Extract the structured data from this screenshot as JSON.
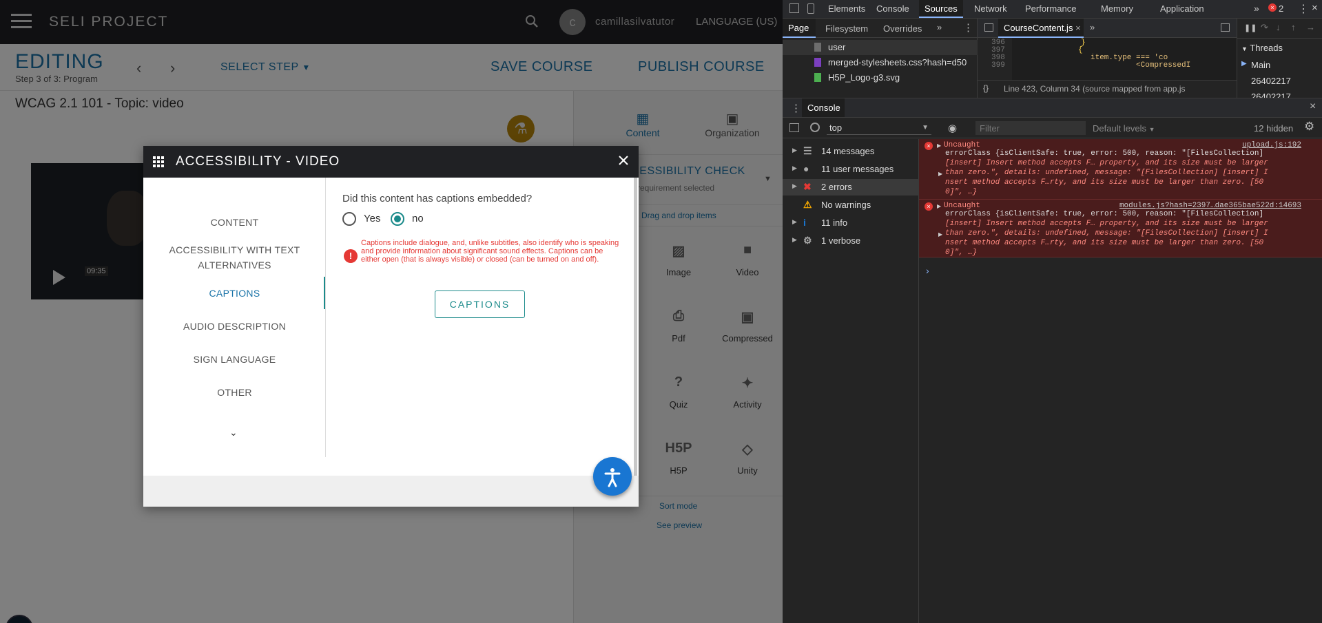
{
  "app": {
    "brand": "SELI PROJECT",
    "user_initial": "c",
    "username": "camillasilvatutor",
    "language": "LANGUAGE (US)",
    "editing": "EDITING",
    "step_text": "Step 3 of 3: Program",
    "select_step": "SELECT STEP",
    "save_course": "SAVE COURSE",
    "publish_course": "PUBLISH COURSE",
    "course_title": "WCAG 2.1 101 - Topic: video",
    "video_time": "09:35",
    "panel_tabs": [
      {
        "label": "Content"
      },
      {
        "label": "Organization"
      }
    ],
    "accessibility_check": "ACCESSIBILITY CHECK",
    "requirement": "requirement selected",
    "drag_drop": "Drag and drop items",
    "tools": [
      {
        "label": "Image",
        "icon": "image-icon"
      },
      {
        "label": "Video",
        "icon": "video-icon"
      },
      {
        "label": "Pdf",
        "icon": "pdf-icon"
      },
      {
        "label": "Compressed",
        "icon": "compressed-icon"
      },
      {
        "label": "Quiz",
        "icon": "quiz-icon"
      },
      {
        "label": "Activity",
        "icon": "activity-icon"
      },
      {
        "label": "H5P",
        "icon": "h5p-icon"
      },
      {
        "label": "Unity",
        "icon": "unity-icon"
      }
    ],
    "sort_mode": "Sort mode",
    "see_preview": "See preview"
  },
  "dialog": {
    "title": "ACCESSIBILITY - VIDEO",
    "nav": [
      "CONTENT",
      "ACCESSIBILITY WITH TEXT ALTERNATIVES",
      "CAPTIONS",
      "AUDIO DESCRIPTION",
      "SIGN LANGUAGE",
      "OTHER"
    ],
    "active_nav": "CAPTIONS",
    "question": "Did this content has captions embedded?",
    "yes": "Yes",
    "no": "no",
    "selected": "no",
    "warning": "Captions include dialogue, and, unlike subtitles, also identify who is speaking and provide information about significant sound effects. Captions can be either open (that is always visible) or closed (can be turned on and off).",
    "captions_button": "CAPTIONS"
  },
  "devtools": {
    "tabs": [
      "Elements",
      "Console",
      "Sources",
      "Network",
      "Performance",
      "Memory",
      "Application"
    ],
    "active_tab": "Sources",
    "error_count": "2",
    "sources_tabs": [
      "Page",
      "Filesystem",
      "Overrides"
    ],
    "files": [
      {
        "name": "user",
        "color": "#6d6d6d"
      },
      {
        "name": "merged-stylesheets.css?hash=d50",
        "color": "#7b3fbf"
      },
      {
        "name": "H5P_Logo-g3.svg",
        "color": "#4caf50"
      }
    ],
    "open_file": "CourseContent.js",
    "code": [
      {
        "ln": "396",
        "text": "}"
      },
      {
        "ln": "397",
        "text": "{"
      },
      {
        "ln": "398",
        "text": "item.type === 'co"
      },
      {
        "ln": "399",
        "text": "<CompressedI"
      }
    ],
    "status": "Line 423, Column 34  (source mapped from app.js",
    "threads_title": "Threads",
    "threads": [
      "Main",
      "26402217",
      "26402217"
    ],
    "console_title": "Console",
    "context": "top",
    "filter_placeholder": "Filter",
    "levels": "Default levels",
    "hidden": "12 hidden",
    "sidebar": [
      {
        "label": "14 messages",
        "icon": "list-icon"
      },
      {
        "label": "11 user messages",
        "icon": "user-icon"
      },
      {
        "label": "2 errors",
        "icon": "error-icon"
      },
      {
        "label": "No warnings",
        "icon": "warning-icon"
      },
      {
        "label": "11 info",
        "icon": "info-icon"
      },
      {
        "label": "1 verbose",
        "icon": "bug-icon"
      }
    ],
    "messages": [
      {
        "head": "Uncaught",
        "source": "upload.js:192",
        "lines": [
          "errorClass {isClientSafe: true, error: 500, reason: \"[FilesCollection]",
          "[insert] Insert method accepts F… property, and its size must be larger",
          "than zero.\", details: undefined, message: \"[FilesCollection] [insert] I",
          "nsert method accepts F…rty, and its size must be larger than zero. [50",
          "0]\", …}"
        ]
      },
      {
        "head": "Uncaught",
        "source": "modules.js?hash=2397…dae365bae522d:14693",
        "lines": [
          "errorClass {isClientSafe: true, error: 500, reason: \"[FilesCollection]",
          "[insert] Insert method accepts F… property, and its size must be larger",
          "than zero.\", details: undefined, message: \"[FilesCollection] [insert] I",
          "nsert method accepts F…rty, and its size must be larger than zero. [50",
          "0]\", …}"
        ]
      }
    ]
  }
}
